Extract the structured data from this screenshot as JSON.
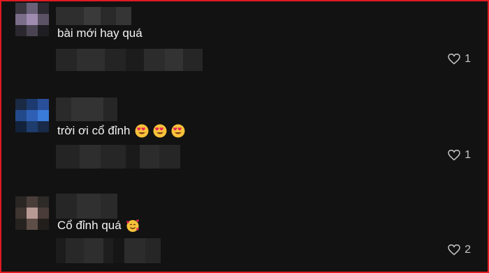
{
  "comments": [
    {
      "text": "bài mới hay quá",
      "likes": "1",
      "emojis": []
    },
    {
      "text": "trời ơi cổ đỉnh",
      "likes": "1",
      "emojis": [
        "heart-eyes-emoji",
        "heart-eyes-emoji",
        "heart-eyes-emoji"
      ]
    },
    {
      "text": "Cổ đỉnh quá",
      "likes": "2",
      "emojis": [
        "smiling-face-with-hearts-emoji"
      ]
    }
  ],
  "colors": {
    "frame_border": "#e01a22",
    "background": "#121212",
    "text": "#f2f2f2",
    "like_text": "#c8c8c8"
  }
}
